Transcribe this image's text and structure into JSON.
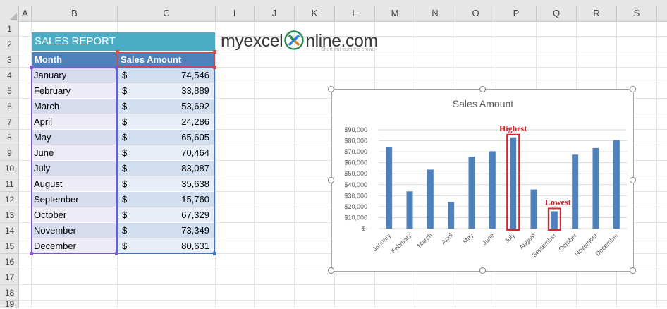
{
  "columns": [
    "A",
    "B",
    "C",
    "I",
    "J",
    "K",
    "L",
    "M",
    "N",
    "O",
    "P",
    "Q",
    "R",
    "S"
  ],
  "rows": [
    "1",
    "2",
    "3",
    "4",
    "5",
    "6",
    "7",
    "8",
    "9",
    "10",
    "11",
    "12",
    "13",
    "14",
    "15",
    "16",
    "17",
    "18",
    "19"
  ],
  "report": {
    "title": "SALES REPORT",
    "col_month": "Month",
    "col_amount": "Sales Amount",
    "currency": "$",
    "entries": [
      {
        "month": "January",
        "amount": "74,546"
      },
      {
        "month": "February",
        "amount": "33,889"
      },
      {
        "month": "March",
        "amount": "53,692"
      },
      {
        "month": "April",
        "amount": "24,286"
      },
      {
        "month": "May",
        "amount": "65,605"
      },
      {
        "month": "June",
        "amount": "70,464"
      },
      {
        "month": "July",
        "amount": "83,087"
      },
      {
        "month": "August",
        "amount": "35,638"
      },
      {
        "month": "September",
        "amount": "15,760"
      },
      {
        "month": "October",
        "amount": "67,329"
      },
      {
        "month": "November",
        "amount": "73,349"
      },
      {
        "month": "December",
        "amount": "80,631"
      }
    ]
  },
  "logo": {
    "text_before": "myexcel",
    "text_after": "nline.com",
    "tagline": "Short out from the crowd"
  },
  "colors": {
    "title_fill": "#4bacc6",
    "header_fill": "#4f81bd",
    "bar": "#4f81bd",
    "highlight": "#e0212b"
  },
  "chart_data": {
    "type": "bar",
    "title": "Sales Amount",
    "categories": [
      "January",
      "February",
      "March",
      "April",
      "May",
      "June",
      "July",
      "August",
      "September",
      "October",
      "November",
      "December"
    ],
    "values": [
      74546,
      33889,
      53692,
      24286,
      65605,
      70464,
      83087,
      35638,
      15760,
      67329,
      73349,
      80631
    ],
    "ylim": [
      0,
      90000
    ],
    "yticks": [
      "$-",
      "$10,000",
      "$20,000",
      "$30,000",
      "$40,000",
      "$50,000",
      "$60,000",
      "$70,000",
      "$80,000",
      "$90,000"
    ],
    "grid": true,
    "annotations": [
      {
        "text": "Highest",
        "category": "July"
      },
      {
        "text": "Lowest",
        "category": "September"
      }
    ]
  }
}
